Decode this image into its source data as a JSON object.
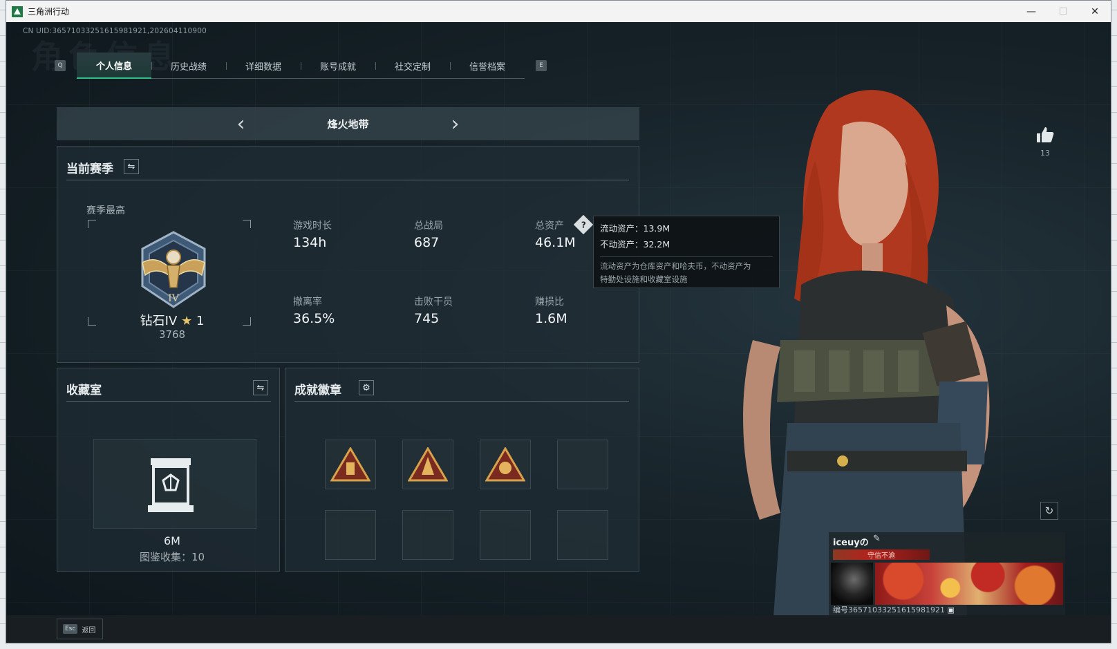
{
  "window": {
    "title": "三角洲行动",
    "controls": [
      "—",
      "☐",
      "✕"
    ]
  },
  "uid_text": "CN UID:3657103325161598192​1,202604110900",
  "watermark": "角色信息",
  "tabs": {
    "left_key": "Q",
    "right_key": "E",
    "items": [
      "个人信息",
      "历史战绩",
      "详细数据",
      "账号成就",
      "社交定制",
      "信誉档案"
    ],
    "active": 0
  },
  "map_selector": {
    "name": "烽火地带",
    "prev": "‹",
    "next": "›"
  },
  "season": {
    "title": "当前赛季",
    "best_label": "赛季最高",
    "rank": "钻石IV",
    "stars": "1",
    "score": "3768",
    "emblem_numeral": "IV",
    "stats": [
      {
        "label": "游戏时长",
        "value": "134h"
      },
      {
        "label": "总战局",
        "value": "687"
      },
      {
        "label": "总资产",
        "value": "46.1M"
      },
      {
        "label": "撤离率",
        "value": "36.5%"
      },
      {
        "label": "击败干员",
        "value": "745"
      },
      {
        "label": "赚损比",
        "value": "1.6M"
      }
    ]
  },
  "tooltip": {
    "liquid": "流动资产：13.9M",
    "fixed": "不动资产：32.2M",
    "note_line1": "流动资产为仓库资产和哈夫币，不动资产为",
    "note_line2": "特勤处设施和收藏室设施"
  },
  "vault": {
    "title": "收藏室",
    "value": "6M",
    "count": "图鉴收集：10"
  },
  "badges": {
    "title": "成就徽章",
    "filled": 3,
    "total": 8
  },
  "likes": {
    "count": "13"
  },
  "player_card": {
    "name": "iceuyの",
    "tag": "守信不渝",
    "id": "编号36571033251615981921"
  },
  "footer": {
    "esc_key": "Esc",
    "back_label": "返回"
  },
  "colors": {
    "accent": "#2fc08a",
    "card_tag": "#b4211d",
    "badge_gold": "#d9a24a"
  }
}
